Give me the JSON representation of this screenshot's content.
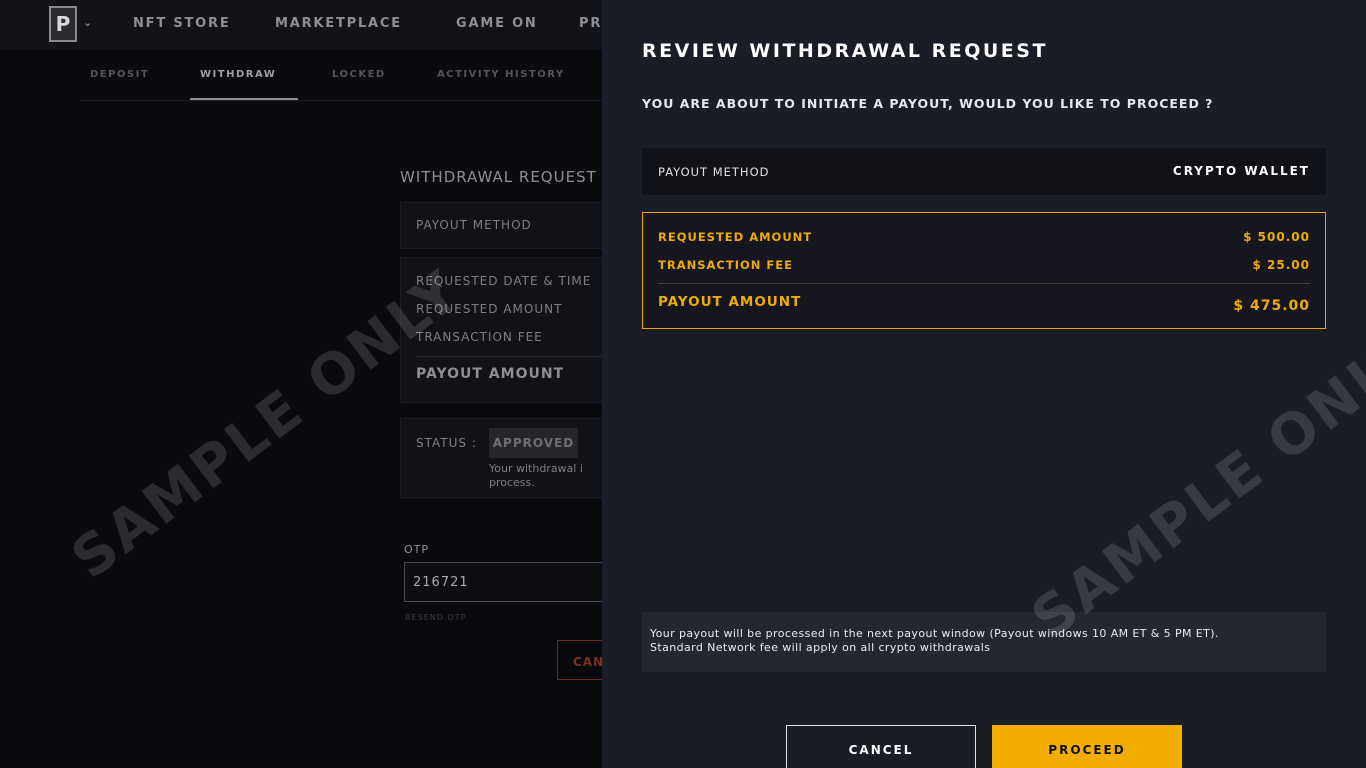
{
  "topnav": {
    "logo_letter": "P",
    "items": [
      "NFT STORE",
      "MARKETPLACE",
      "GAME ON",
      "PR"
    ]
  },
  "subtabs": {
    "items": [
      "DEPOSIT",
      "WITHDRAW",
      "LOCKED",
      "ACTIVITY HISTORY"
    ],
    "active": "WITHDRAW"
  },
  "background_form": {
    "title": "WITHDRAWAL REQUEST",
    "payout_method_label": "PAYOUT METHOD",
    "requested_date_label": "REQUESTED DATE & TIME",
    "requested_amount_label": "REQUESTED AMOUNT",
    "transaction_fee_label": "TRANSACTION FEE",
    "payout_amount_label": "PAYOUT AMOUNT",
    "status_label": "STATUS :",
    "status_value": "APPROVED",
    "status_note_line1": "Your withdrawal i",
    "status_note_line2": "process.",
    "otp_label": "OTP",
    "otp_value": "216721",
    "resend_label": "RESEND OTP",
    "cancel_label": "CAN"
  },
  "watermark": "SAMPLE ONLY",
  "modal": {
    "title": "REVIEW WITHDRAWAL REQUEST",
    "subtitle": "YOU ARE ABOUT TO INITIATE A PAYOUT, WOULD YOU LIKE TO PROCEED ?",
    "payout_method_label": "PAYOUT METHOD",
    "payout_method_value": "CRYPTO WALLET",
    "requested_amount_label": "REQUESTED AMOUNT",
    "requested_amount_value": "$ 500.00",
    "transaction_fee_label": "TRANSACTION FEE",
    "transaction_fee_value": "$ 25.00",
    "payout_amount_label": "PAYOUT AMOUNT",
    "payout_amount_value": "$ 475.00",
    "notice_line1": "Your payout will be processed in the next payout window (Payout windows 10 AM ET & 5 PM ET).",
    "notice_line2": "Standard Network fee will apply on all crypto withdrawals",
    "cancel_label": "CANCEL",
    "proceed_label": "PROCEED"
  },
  "colors": {
    "accent": "#f2ad00",
    "modal_bg": "#1a1c26"
  }
}
